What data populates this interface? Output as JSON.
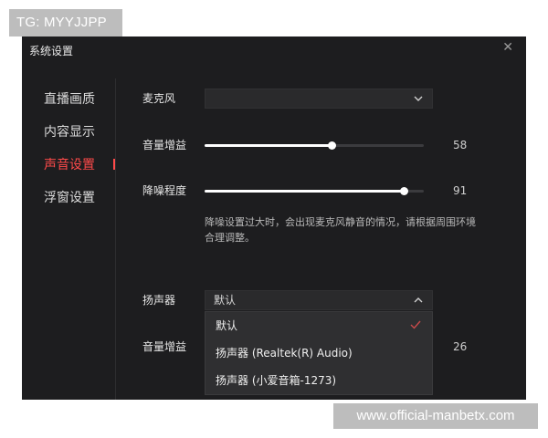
{
  "watermarks": {
    "top_left": "TG: MYYJJPP",
    "bottom_right": "www.official-manbetx.com"
  },
  "window": {
    "title": "系统设置",
    "close_icon": "close-icon"
  },
  "sidebar": {
    "items": [
      {
        "label": "直播画质",
        "active": false
      },
      {
        "label": "内容显示",
        "active": false
      },
      {
        "label": "声音设置",
        "active": true
      },
      {
        "label": "浮窗设置",
        "active": false
      }
    ],
    "accent_color": "#ff4a4a"
  },
  "microphone": {
    "label": "麦克风",
    "value": "",
    "caret_icon": "chevron-down-icon"
  },
  "mic_gain": {
    "label": "音量增益",
    "value": 58,
    "value_text": "58"
  },
  "noise_reduction": {
    "label": "降噪程度",
    "value": 91,
    "value_text": "91"
  },
  "hint": "降噪设置过大时，会出现麦克风静音的情况，请根据周围环境合理调整。",
  "speaker": {
    "label": "扬声器",
    "value": "默认",
    "caret_icon": "chevron-up-icon",
    "options": [
      {
        "label": "默认",
        "selected": true
      },
      {
        "label": "扬声器 (Realtek(R) Audio)",
        "selected": false
      },
      {
        "label": "扬声器 (小爱音箱-1273)",
        "selected": false
      }
    ]
  },
  "speaker_gain": {
    "label": "音量增益",
    "value_text": "26"
  }
}
